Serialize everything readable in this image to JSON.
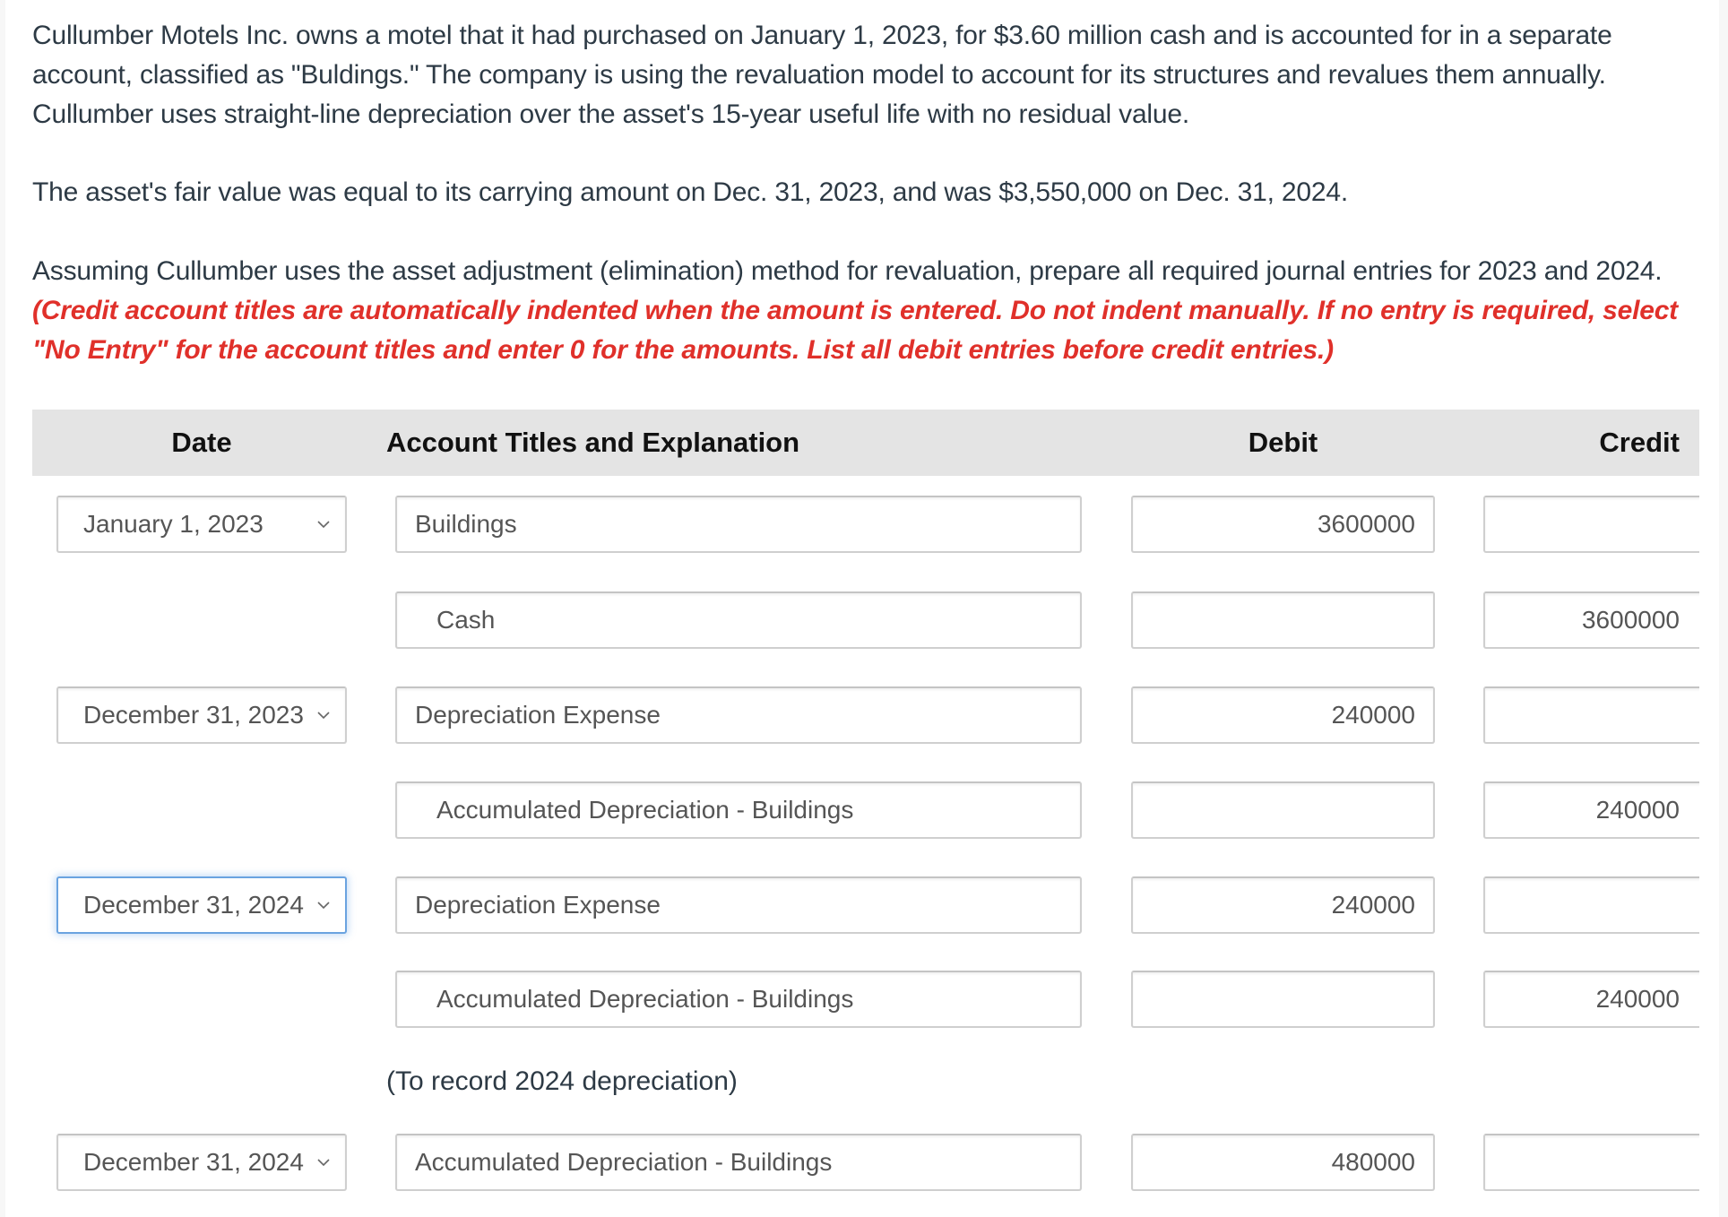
{
  "problem": {
    "paragraph1": "Cullumber Motels Inc. owns a motel that it had purchased on January 1, 2023, for $3.60 million cash and is accounted for in a separate account, classified as \"Buldings.\" The company is using the revaluation model to account for its structures and revalues them annually. Cullumber uses straight-line depreciation over the asset's 15-year useful life with no residual value.",
    "paragraph2": "The asset's fair value was equal to its carrying amount on Dec. 31, 2023, and was $3,550,000 on Dec. 31, 2024.",
    "paragraph3_plain": "Assuming Cullumber uses the asset adjustment (elimination) method for revaluation, prepare all required journal entries for 2023 and 2024. ",
    "paragraph3_instruction": "(Credit account titles are automatically indented when the amount is entered. Do not indent manually. If no entry is required, select \"No Entry\" for the account titles and enter 0 for the amounts. List all debit entries before credit entries.)",
    "instruction_color": "#e0302a"
  },
  "table": {
    "headers": {
      "date": "Date",
      "account": "Account Titles and Explanation",
      "debit": "Debit",
      "credit": "Credit"
    },
    "rows": [
      {
        "date": "January 1, 2023",
        "account": "Buildings",
        "debit": "3600000",
        "credit": ""
      },
      {
        "date": "",
        "account": "Cash",
        "debit": "",
        "credit": "3600000"
      },
      {
        "date": "December 31, 2023",
        "account": "Depreciation Expense",
        "debit": "240000",
        "credit": ""
      },
      {
        "date": "",
        "account": "Accumulated Depreciation - Buildings",
        "debit": "",
        "credit": "240000"
      },
      {
        "date": "December 31, 2024",
        "account": "Depreciation Expense",
        "debit": "240000",
        "credit": "",
        "focused": true
      },
      {
        "date": "",
        "account": "Accumulated Depreciation - Buildings",
        "debit": "",
        "credit": "240000"
      },
      {
        "date": "December 31, 2024",
        "account": "Accumulated Depreciation - Buildings",
        "debit": "480000",
        "credit": ""
      }
    ],
    "note_after_row_6": "(To record 2024 depreciation)",
    "focus_color": "#6aa3e0"
  }
}
